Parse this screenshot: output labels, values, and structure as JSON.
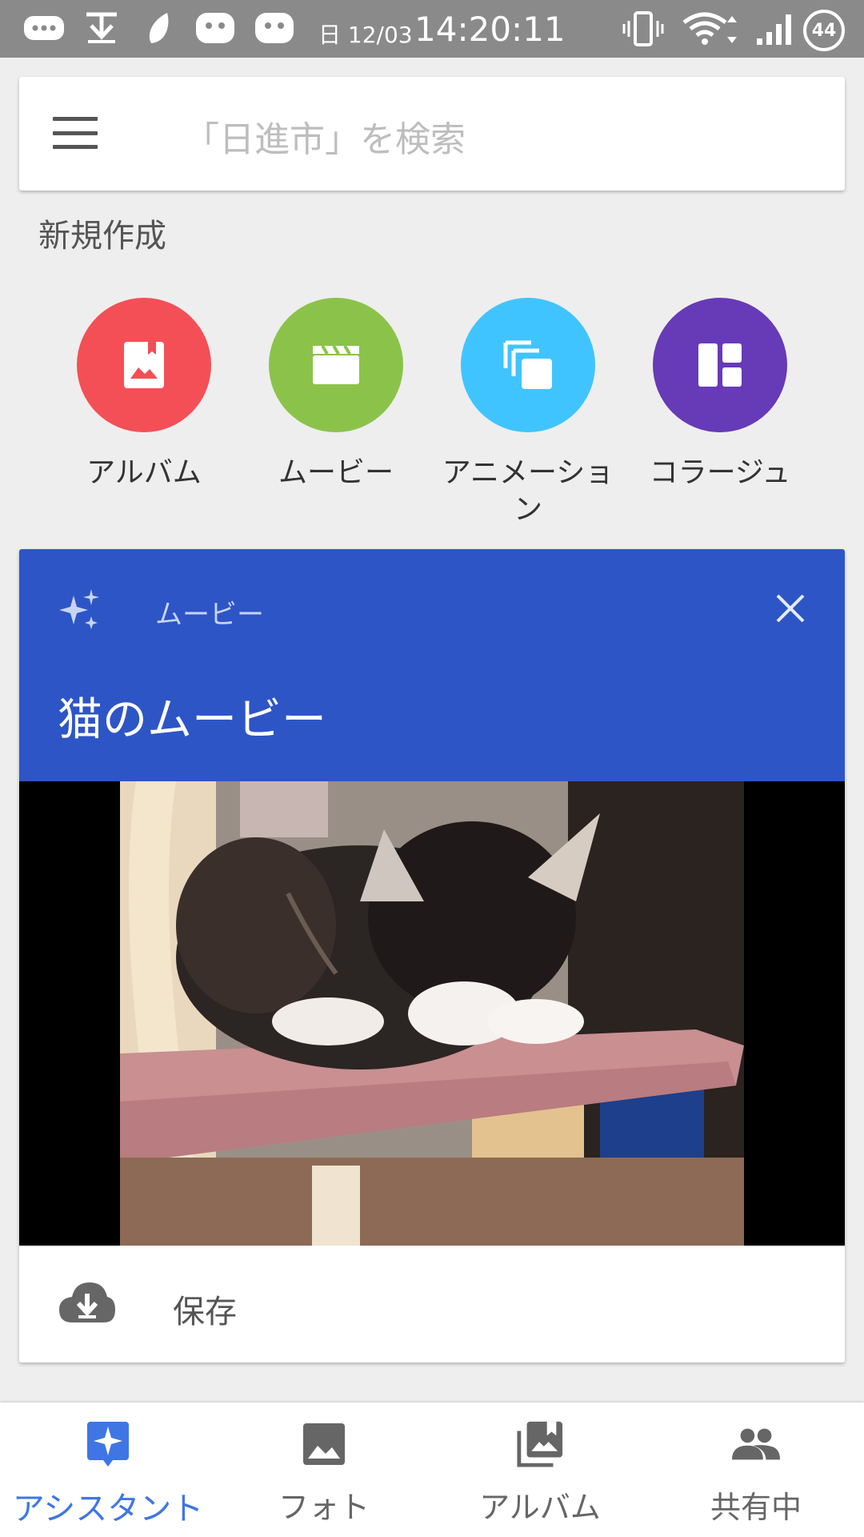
{
  "status_bar": {
    "date": "日 12/03",
    "time": "14:20:11",
    "battery": "44"
  },
  "search": {
    "placeholder": "「日進市」を検索"
  },
  "create_section": {
    "title": "新規作成",
    "items": [
      {
        "label": "アルバム",
        "color": "#f44f56",
        "icon": "album-photo-icon"
      },
      {
        "label": "ムービー",
        "color": "#8bc34a",
        "icon": "clapperboard-icon"
      },
      {
        "label": "アニメーション",
        "color": "#40c4ff",
        "icon": "stacked-frames-icon"
      },
      {
        "label": "コラージュ",
        "color": "#673ab7",
        "icon": "collage-grid-icon"
      }
    ]
  },
  "card": {
    "kind": "ムービー",
    "title": "猫のムービー",
    "header_color": "#2d55c6",
    "save_label": "保存"
  },
  "bottom_nav": {
    "items": [
      {
        "label": "アシスタント",
        "icon": "assistant-sparkle-icon",
        "active": true
      },
      {
        "label": "フォト",
        "icon": "photo-icon",
        "active": false
      },
      {
        "label": "アルバム",
        "icon": "photo-album-icon",
        "active": false
      },
      {
        "label": "共有中",
        "icon": "people-icon",
        "active": false
      }
    ]
  },
  "colors": {
    "accent": "#3f76e4",
    "statusbar": "#8a8a8a"
  }
}
